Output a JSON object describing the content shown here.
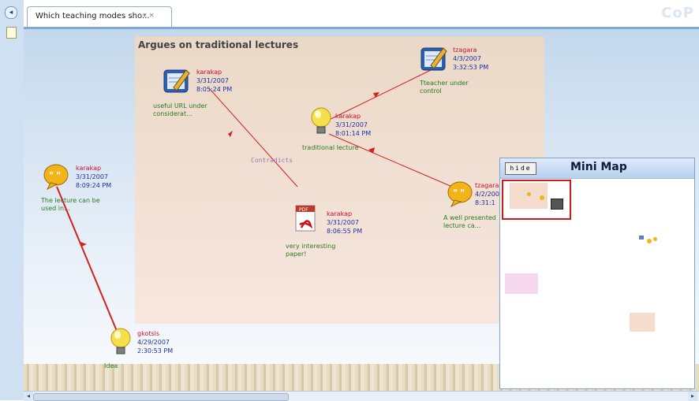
{
  "app": {
    "brand": "CoP",
    "tab_title": "Which teaching modes sho...",
    "tab_menu": "▾ ×"
  },
  "region": {
    "title": "Argues on traditional lectures"
  },
  "edge_label": "Contradicts",
  "nodes": [
    {
      "type": "note",
      "author": "karakap",
      "date": "3/31/2007",
      "time": "8:05:24 PM",
      "label_1": "useful URL under",
      "label_2": "considerat..."
    },
    {
      "type": "note",
      "author": "tzagara",
      "date": "4/3/2007",
      "time": "3:32:53 PM",
      "label_1": "Tteacher under",
      "label_2": "control"
    },
    {
      "type": "idea",
      "author": "karakap",
      "date": "3/31/2007",
      "time": "8:01:14 PM",
      "label_1": "traditional lecture",
      "label_2": ""
    },
    {
      "type": "argument",
      "author": "karakap",
      "date": "3/31/2007",
      "time": "8:09:24 PM",
      "label_1": "The lecture can be",
      "label_2": "used in..."
    },
    {
      "type": "pdf",
      "author": "karakap",
      "date": "3/31/2007",
      "time": "8:06:55 PM",
      "label_1": "very interesting",
      "label_2": "paper!"
    },
    {
      "type": "argument",
      "author": "tzagara",
      "date": "4/2/200",
      "time": "8:31:1",
      "label_1": "A well presented",
      "label_2": "lecture ca..."
    },
    {
      "type": "idea",
      "author": "gkotsis",
      "date": "4/29/2007",
      "time": "2:30:53 PM",
      "label_1": "Idea",
      "label_2": ""
    }
  ],
  "minimap": {
    "hide_label": "hide",
    "title": "Mini Map"
  },
  "colors": {
    "edge": "#d42020",
    "accent": "#7ea8d6"
  }
}
